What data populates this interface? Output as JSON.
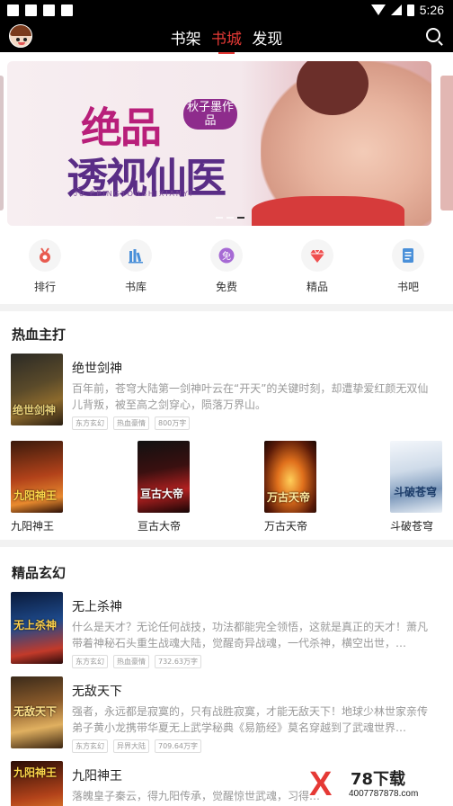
{
  "status_bar": {
    "time": "5:26"
  },
  "nav": {
    "tabs": [
      {
        "label": "书架",
        "active": false
      },
      {
        "label": "书城",
        "active": true
      },
      {
        "label": "发现",
        "active": false
      }
    ],
    "accent_color": "#e53935"
  },
  "banner": {
    "title_line1": "绝品",
    "title_line2": "透视仙医",
    "seal_text": "秋子墨作品",
    "pinyin": "JU ÉPINGTOUSHIXIANYI",
    "slide_count": 3,
    "active_slide": 3
  },
  "quick_menu": [
    {
      "label": "排行",
      "icon": "medal-icon"
    },
    {
      "label": "书库",
      "icon": "library-icon"
    },
    {
      "label": "免费",
      "icon": "free-icon"
    },
    {
      "label": "精品",
      "icon": "diamond-icon"
    },
    {
      "label": "书吧",
      "icon": "document-icon"
    }
  ],
  "section1": {
    "title": "热血主打",
    "featured": {
      "title": "绝世剑神",
      "desc": "百年前，苍穹大陆第一剑神叶云在“开天”的关键时刻，却遭挚爱红颜无双仙儿背叛，被至高之剑穿心，陨落万界山。",
      "tags": [
        "东方玄幻",
        "热血豪情",
        "800万字"
      ],
      "cover_text": "绝世剑神"
    },
    "grid": [
      {
        "title": "九阳神王",
        "cover_text": "九阳神王"
      },
      {
        "title": "亘古大帝",
        "cover_text": "亘古大帝"
      },
      {
        "title": "万古天帝",
        "cover_text": "万古天帝"
      },
      {
        "title": "斗破苍穹",
        "cover_text": "斗破苍穹"
      }
    ]
  },
  "section2": {
    "title": "精品玄幻",
    "books": [
      {
        "title": "无上杀神",
        "desc": "什么是天才？无论任何战技，功法都能完全领悟，这就是真正的天才！萧凡带着神秘石头重生战魂大陆，觉醒奇异战魂，一代杀神，横空出世，…",
        "tags": [
          "东方玄幻",
          "热血豪情",
          "732.63万字"
        ],
        "cover_text": "无上杀神"
      },
      {
        "title": "无敌天下",
        "desc": "强者，永远都是寂寞的，只有战胜寂寞，才能无敌天下！地球少林世家亲传弟子黄小龙携带华夏无上武学秘典《易筋经》莫名穿越到了武魂世界…",
        "tags": [
          "东方玄幻",
          "异界大陆",
          "709.64万字"
        ],
        "cover_text": "无敌天下"
      },
      {
        "title": "九阳神王",
        "desc": "落魄皇子秦云，得九阳传承，觉醒惊世武魂，习得…",
        "tags": [],
        "cover_text": "九阳神王"
      }
    ]
  },
  "watermark": {
    "brand": "78下载",
    "url": "4007787878.com"
  }
}
